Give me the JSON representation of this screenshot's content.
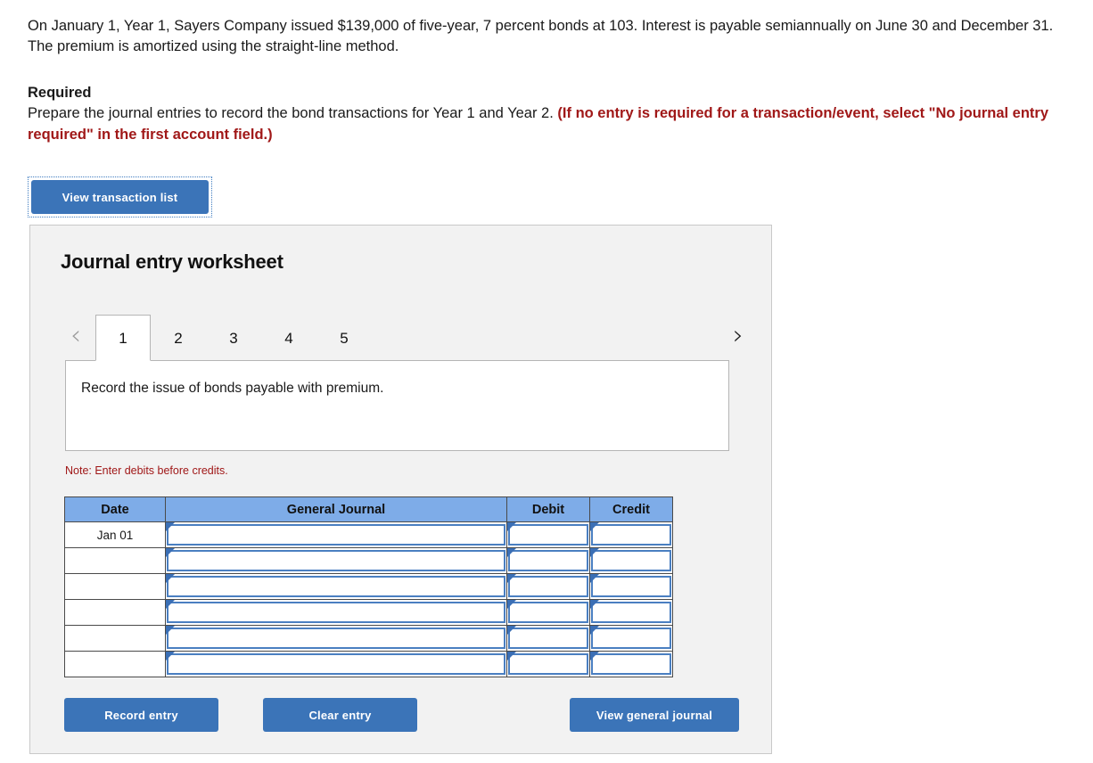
{
  "problem": {
    "text": "On January 1, Year 1, Sayers Company issued $139,000 of five-year, 7 percent bonds at 103. Interest is payable semiannually on June 30 and December 31. The premium is amortized using the straight-line method."
  },
  "required": {
    "title": "Required",
    "instruction": "Prepare the journal entries to record the bond transactions for Year 1 and Year 2. ",
    "note_red": "(If no entry is required for a transaction/event, select \"No journal entry required\" in the first account field.)"
  },
  "toolbar": {
    "view_transaction_list_label": "View transaction list"
  },
  "worksheet": {
    "title": "Journal entry worksheet",
    "prev_icon": "chevron-left-icon",
    "next_icon": "chevron-right-icon",
    "tabs": [
      {
        "label": "1",
        "active": true
      },
      {
        "label": "2",
        "active": false
      },
      {
        "label": "3",
        "active": false
      },
      {
        "label": "4",
        "active": false
      },
      {
        "label": "5",
        "active": false
      }
    ],
    "description": "Record the issue of bonds payable with premium.",
    "note": "Note: Enter debits before credits.",
    "table": {
      "headers": [
        "Date",
        "General Journal",
        "Debit",
        "Credit"
      ],
      "rows": [
        {
          "date": "Jan 01",
          "general_journal": "",
          "debit": "",
          "credit": ""
        },
        {
          "date": "",
          "general_journal": "",
          "debit": "",
          "credit": ""
        },
        {
          "date": "",
          "general_journal": "",
          "debit": "",
          "credit": ""
        },
        {
          "date": "",
          "general_journal": "",
          "debit": "",
          "credit": ""
        },
        {
          "date": "",
          "general_journal": "",
          "debit": "",
          "credit": ""
        },
        {
          "date": "",
          "general_journal": "",
          "debit": "",
          "credit": ""
        }
      ]
    },
    "actions": {
      "record_entry": "Record entry",
      "clear_entry": "Clear entry",
      "view_general_journal": "View general journal"
    }
  },
  "colors": {
    "button_blue": "#3b74b8",
    "table_header_blue": "#7eace8",
    "cell_border_blue": "#4a7fc1",
    "alert_red": "#a01818",
    "panel_bg": "#f2f2f2"
  }
}
